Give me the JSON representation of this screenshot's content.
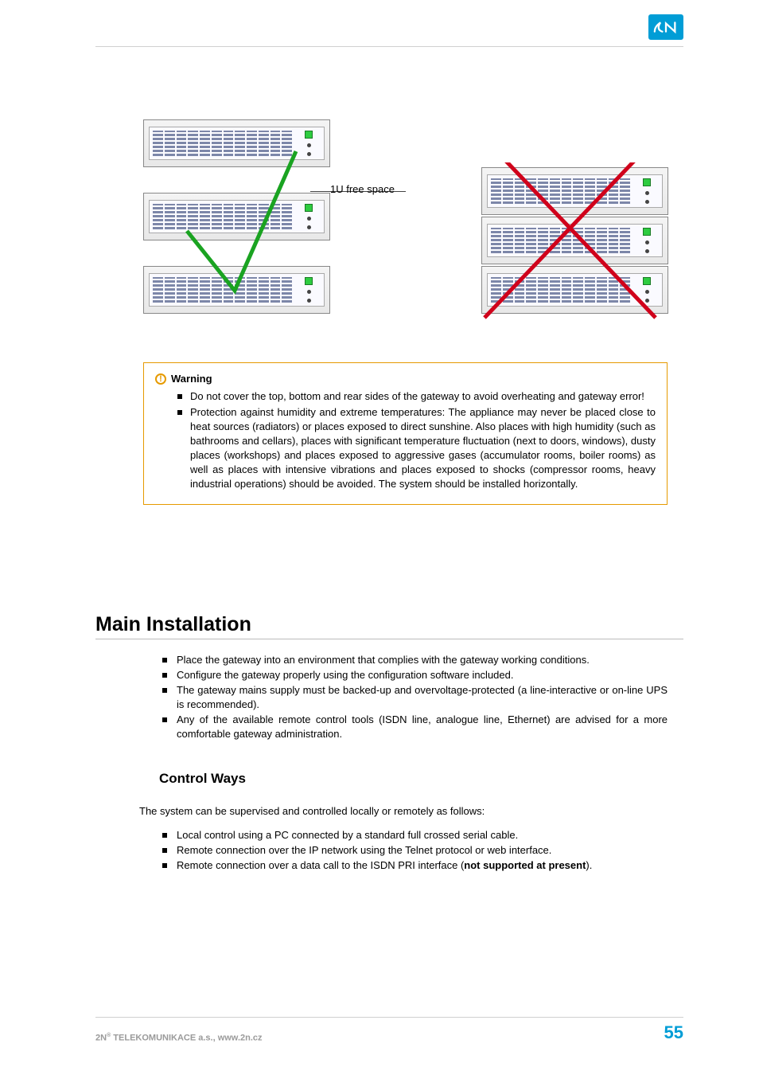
{
  "brand": "2N",
  "diagram": {
    "callout": "1U free space"
  },
  "warning": {
    "title": "Warning",
    "items": [
      "Do not cover the top, bottom and rear sides of the gateway to avoid overheating and gateway error!",
      "Protection against humidity and extreme temperatures: The appliance may never be placed close to heat sources (radiators) or places exposed to direct sunshine. Also places with high humidity (such as bathrooms and cellars), places with significant temperature fluctuation (next to doors, windows), dusty places (workshops) and places exposed to aggressive gases (accumulator rooms, boiler rooms) as well as places with intensive vibrations and places exposed to shocks (compressor rooms, heavy industrial operations) should be avoided. The system should be installed horizontally."
    ]
  },
  "heading_main": "Main Installation",
  "main_list": [
    "Place the gateway into an environment that complies with the gateway working conditions.",
    "Configure the gateway properly using the configuration software included.",
    "The gateway mains supply must be backed-up and overvoltage-protected (a line-interactive or on-line UPS is recommended).",
    "Any of the available remote control tools (ISDN line, analogue line, Ethernet) are advised for a more comfortable gateway administration."
  ],
  "heading_sub": "Control Ways",
  "control_intro": "The system can be supervised and controlled locally or remotely as follows:",
  "control_list": {
    "i0": "Local control using a PC connected by a standard full crossed serial cable.",
    "i1": "Remote connection over the IP network using the Telnet protocol or web interface.",
    "i2_pre": "Remote connection over a data call to the ISDN PRI interface (",
    "i2_bold": "not supported at present",
    "i2_post": ")."
  },
  "footer": {
    "company_prefix": "2N",
    "reg": "®",
    "company_rest": " TELEKOMUNIKACE a.s., www.2n.cz",
    "page": "55"
  }
}
